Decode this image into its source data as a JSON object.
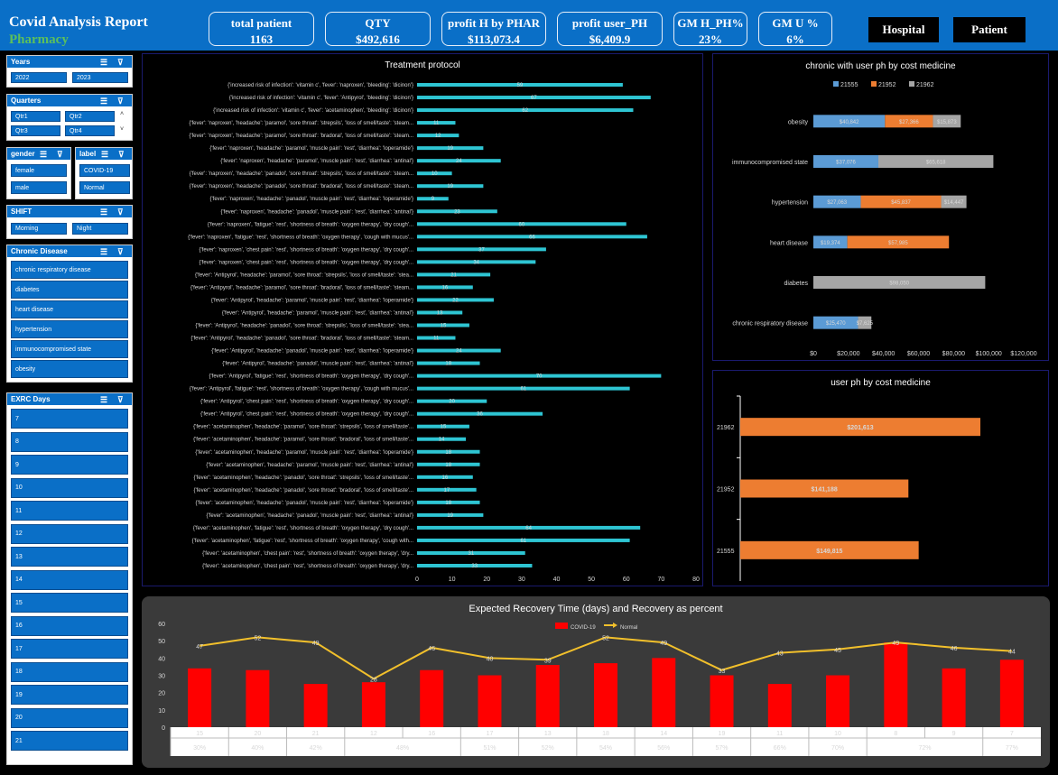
{
  "header": {
    "title": "Covid Analysis Report",
    "subtitle": "Pharmacy",
    "kpis": [
      {
        "label": "total patient",
        "value": "1163"
      },
      {
        "label": "QTY",
        "value": "$492,616"
      },
      {
        "label": "profit H by PHAR",
        "value": "$113,073.4"
      },
      {
        "label": "profit user_PH",
        "value": "$6,409.9"
      },
      {
        "label": "GM H_PH%",
        "value": "23%"
      },
      {
        "label": "GM U %",
        "value": "6%"
      }
    ],
    "buttons": {
      "hospital": "Hospital",
      "patient": "Patient"
    }
  },
  "slicers": {
    "years": {
      "title": "Years",
      "items": [
        "2022",
        "2023"
      ]
    },
    "quarters": {
      "title": "Quarters",
      "items": [
        "Qtr1",
        "Qtr2",
        "Qtr3",
        "Qtr4"
      ]
    },
    "gender": {
      "title": "gender",
      "items": [
        "female",
        "male"
      ]
    },
    "label": {
      "title": "label",
      "items": [
        "COVID-19",
        "Normal"
      ]
    },
    "shift": {
      "title": "SHIFT",
      "items": [
        "Morning",
        "Night"
      ]
    },
    "chronic": {
      "title": "Chronic Disease",
      "items": [
        "chronic respiratory disease",
        "diabetes",
        "heart disease",
        "hypertension",
        "immunocompromised state",
        "obesity"
      ]
    },
    "exrc": {
      "title": "EXRC Days",
      "items": [
        "7",
        "8",
        "9",
        "10",
        "11",
        "12",
        "13",
        "14",
        "15",
        "16",
        "17",
        "18",
        "19",
        "20",
        "21"
      ]
    }
  },
  "colors": {
    "accent": "#0a6fc7",
    "teal": "#2ec5d3",
    "orange": "#ed7d31",
    "blue": "#5b9bd5",
    "gray": "#a5a5a5",
    "red": "#ff0000",
    "gold": "#f2c02b"
  },
  "chart_data": [
    {
      "type": "bar",
      "title": "Treatment protocol",
      "orientation": "horizontal",
      "xlim": [
        0,
        80
      ],
      "xticks": [
        "0",
        "10",
        "20",
        "30",
        "40",
        "50",
        "60",
        "70",
        "80"
      ],
      "categories": [
        "{'increased risk of infection': 'vitamin c', 'fever': 'naproxen', 'bleeding': 'dicinon'}",
        "{'increased risk of infection': 'vitamin c', 'fever': 'Antipyrol', 'bleeding': 'dicinon'}",
        "{'increased risk of infection': 'vitamin c', 'fever': 'acetaminophen', 'bleeding': 'dicinon'}",
        "{'fever': 'naproxen', 'headache': 'paramol', 'sore throat': 'strepsils', 'loss of smell/taste': 'steam...",
        "{'fever': 'naproxen', 'headache': 'paramol', 'sore throat': 'bradoral', 'loss of smell/taste': 'steam...",
        "{'fever': 'naproxen', 'headache': 'paramol', 'muscle pain': 'rest', 'diarrhea': 'loperamide'}",
        "{'fever': 'naproxen', 'headache': 'paramol', 'muscle pain': 'rest', 'diarrhea': 'antinal'}",
        "{'fever': 'naproxen', 'headache': 'panadol', 'sore throat': 'strepsils', 'loss of smell/taste': 'steam...",
        "{'fever': 'naproxen', 'headache': 'panadol', 'sore throat': 'bradoral', 'loss of smell/taste': 'steam...",
        "{'fever': 'naproxen', 'headache': 'panadol', 'muscle pain': 'rest', 'diarrhea': 'loperamide'}",
        "{'fever': 'naproxen', 'headache': 'panadol', 'muscle pain': 'rest', 'diarrhea': 'antinal'}",
        "{'fever': 'naproxen', 'fatigue': 'rest', 'shortness of breath': 'oxygen therapy', 'dry cough'...",
        "{'fever': 'naproxen', 'fatigue': 'rest', 'shortness of breath': 'oxygen therapy', 'cough with mucus'...",
        "{'fever': 'naproxen', 'chest pain': 'rest', 'shortness of breath': 'oxygen therapy', 'dry cough'...",
        "{'fever': 'naproxen', 'chest pain': 'rest', 'shortness of breath': 'oxygen therapy', 'dry cough'...",
        "{'fever': 'Antipyrol', 'headache': 'paramol', 'sore throat': 'strepsils', 'loss of smell/taste': 'steam...",
        "{'fever': 'Antipyrol', 'headache': 'paramol', 'sore throat': 'bradoral', 'loss of smell/taste': 'steam...",
        "{'fever': 'Antipyrol', 'headache': 'paramol', 'muscle pain': 'rest', 'diarrhea': 'loperamide'}",
        "{'fever': 'Antipyrol', 'headache': 'paramol', 'muscle pain': 'rest', 'diarrhea': 'antinal'}",
        "{'fever': 'Antipyrol', 'headache': 'panadol', 'sore throat': 'strepsils', 'loss of smell/taste': 'steam...",
        "{'fever': 'Antipyrol', 'headache': 'panadol', 'sore throat': 'bradoral', 'loss of smell/taste': 'steam...",
        "{'fever': 'Antipyrol', 'headache': 'panadol', 'muscle pain': 'rest', 'diarrhea': 'loperamide'}",
        "{'fever': 'Antipyrol', 'headache': 'panadol', 'muscle pain': 'rest', 'diarrhea': 'antinal'}",
        "{'fever': 'Antipyrol', 'fatigue': 'rest', 'shortness of breath': 'oxygen therapy', 'dry cough'...",
        "{'fever': 'Antipyrol', 'fatigue': 'rest', 'shortness of breath': 'oxygen therapy', 'cough with mucus'...",
        "{'fever': 'Antipyrol', 'chest pain': 'rest', 'shortness of breath': 'oxygen therapy', 'dry cough'...",
        "{'fever': 'Antipyrol', 'chest pain': 'rest', 'shortness of breath': 'oxygen therapy', 'dry cough'...",
        "{'fever': 'acetaminophen', 'headache': 'paramol', 'sore throat': 'strepsils', 'loss of smell/taste'...",
        "{'fever': 'acetaminophen', 'headache': 'paramol', 'sore throat': 'bradoral', 'loss of smell/taste'...",
        "{'fever': 'acetaminophen', 'headache': 'paramol', 'muscle pain': 'rest', 'diarrhea': 'loperamide'}",
        "{'fever': 'acetaminophen', 'headache': 'paramol', 'muscle pain': 'rest', 'diarrhea': 'antinal'}",
        "{'fever': 'acetaminophen', 'headache': 'panadol', 'sore throat': 'strepsils', 'loss of smell/taste'...",
        "{'fever': 'acetaminophen', 'headache': 'panadol', 'sore throat': 'bradoral', 'loss of smell/taste'...",
        "{'fever': 'acetaminophen', 'headache': 'panadol', 'muscle pain': 'rest', 'diarrhea': 'loperamide'}",
        "{'fever': 'acetaminophen', 'headache': 'panadol', 'muscle pain': 'rest', 'diarrhea': 'antinal'}",
        "{'fever': 'acetaminophen', 'fatigue': 'rest', 'shortness of breath': 'oxygen therapy', 'dry cough'...",
        "{'fever': 'acetaminophen', 'fatigue': 'rest', 'shortness of breath': 'oxygen therapy', 'cough with...",
        "{'fever': 'acetaminophen', 'chest pain': 'rest', 'shortness of breath': 'oxygen therapy', 'dry...",
        "{'fever': 'acetaminophen', 'chest pain': 'rest', 'shortness of breath': 'oxygen therapy', 'dry..."
      ],
      "values": [
        59,
        67,
        62,
        11,
        12,
        19,
        24,
        10,
        19,
        9,
        23,
        60,
        66,
        37,
        34,
        21,
        16,
        22,
        13,
        15,
        11,
        24,
        18,
        70,
        61,
        20,
        36,
        15,
        14,
        18,
        18,
        16,
        17,
        18,
        19,
        64,
        61,
        31,
        33
      ]
    },
    {
      "type": "bar",
      "title": "chronic with user ph by cost medicine",
      "orientation": "horizontal-stacked",
      "legend_position": "top",
      "xlim": [
        0,
        120000
      ],
      "xticks": [
        "$0",
        "$20,000",
        "$40,000",
        "$60,000",
        "$80,000",
        "$100,000",
        "$120,000"
      ],
      "categories": [
        "obesity",
        "immunocompromised state",
        "hypertension",
        "heart disease",
        "diabetes",
        "chronic respiratory disease"
      ],
      "series": [
        {
          "name": "21555",
          "color": "#5b9bd5",
          "values": [
            40842,
            37076,
            27063,
            19374,
            0,
            25470
          ],
          "labels": [
            "$40,842",
            "$37,076",
            "$27,063",
            "$19,374",
            "",
            "$25,470"
          ]
        },
        {
          "name": "21952",
          "color": "#ed7d31",
          "values": [
            27366,
            0,
            45837,
            57985,
            0,
            0
          ],
          "labels": [
            "$27,366",
            "",
            "$45,837",
            "$57,985",
            "",
            ""
          ]
        },
        {
          "name": "21962",
          "color": "#a5a5a5",
          "values": [
            15873,
            65618,
            14447,
            0,
            98050,
            7625
          ],
          "labels": [
            "$15,873",
            "$65,618",
            "$14,447",
            "",
            "$98,050",
            "$7,625"
          ]
        }
      ]
    },
    {
      "type": "bar",
      "title": "user ph by cost medicine",
      "orientation": "horizontal",
      "categories": [
        "21962",
        "21952",
        "21555"
      ],
      "values": [
        201613,
        141188,
        149815
      ],
      "labels": [
        "$201,613",
        "$141,188",
        "$149,815"
      ]
    },
    {
      "type": "bar",
      "title": "Expected Recovery Time (days)  and Recovery as percent",
      "ylim": [
        0,
        60
      ],
      "yticks": [
        "0",
        "10",
        "20",
        "30",
        "40",
        "50",
        "60"
      ],
      "categories": [
        "15",
        "20",
        "21",
        "12",
        "16",
        "17",
        "13",
        "18",
        "14",
        "19",
        "11",
        "10",
        "8",
        "9",
        "7"
      ],
      "pct_groups": [
        {
          "label": "30%",
          "span": 1
        },
        {
          "label": "40%",
          "span": 1
        },
        {
          "label": "42%",
          "span": 1
        },
        {
          "label": "48%",
          "span": 2
        },
        {
          "label": "51%",
          "span": 1
        },
        {
          "label": "52%",
          "span": 1
        },
        {
          "label": "54%",
          "span": 1
        },
        {
          "label": "56%",
          "span": 1
        },
        {
          "label": "57%",
          "span": 1
        },
        {
          "label": "66%",
          "span": 1
        },
        {
          "label": "70%",
          "span": 1
        },
        {
          "label": "72%",
          "span": 2
        },
        {
          "label": "77%",
          "span": 1
        }
      ],
      "series": [
        {
          "name": "COVID-19",
          "type": "bar",
          "color": "#ff0000",
          "values": [
            34,
            33,
            25,
            26,
            33,
            30,
            36,
            37,
            40,
            30,
            25,
            30,
            49,
            34,
            39
          ]
        },
        {
          "name": "Normal",
          "type": "line",
          "color": "#f2c02b",
          "values": [
            47,
            52,
            49,
            28,
            46,
            40,
            39,
            52,
            49,
            33,
            43,
            45,
            49,
            46,
            44
          ]
        }
      ]
    }
  ]
}
